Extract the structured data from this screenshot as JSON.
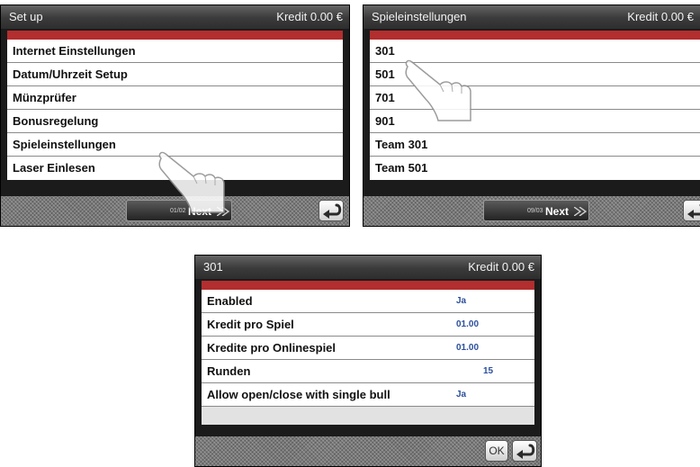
{
  "setup_screen": {
    "title": "Set up",
    "kredit": "Kredit 0.00 €",
    "items": [
      {
        "label": "Internet Einstellungen"
      },
      {
        "label": "Datum/Uhrzeit Setup"
      },
      {
        "label": "Münzprüfer"
      },
      {
        "label": "Bonusregelung"
      },
      {
        "label": "Spieleinstellungen"
      },
      {
        "label": "Laser Einlesen"
      }
    ],
    "page": "01/02",
    "next_label": "Next"
  },
  "game_settings_screen": {
    "title": "Spieleinstellungen",
    "kredit": "Kredit 0.00 €",
    "items": [
      {
        "label": "301"
      },
      {
        "label": "501"
      },
      {
        "label": "701"
      },
      {
        "label": "901"
      },
      {
        "label": "Team 301"
      },
      {
        "label": "Team 501"
      }
    ],
    "page": "09/03",
    "next_label": "Next"
  },
  "game301_screen": {
    "title": "301",
    "kredit": "Kredit 0.00 €",
    "settings": [
      {
        "label": "Enabled",
        "value": "Ja"
      },
      {
        "label": "Kredit pro Spiel",
        "value": "01.00"
      },
      {
        "label": "Kredite pro Onlinespiel",
        "value": "01.00"
      },
      {
        "label": "Runden",
        "value": "15"
      },
      {
        "label": "Allow open/close with single bull",
        "value": "Ja"
      }
    ],
    "ok_label": "OK"
  },
  "icons": {
    "next_arrow": "double-chevron-right-icon",
    "back": "return-arrow-icon",
    "pointer": "pointing-hand-icon"
  }
}
